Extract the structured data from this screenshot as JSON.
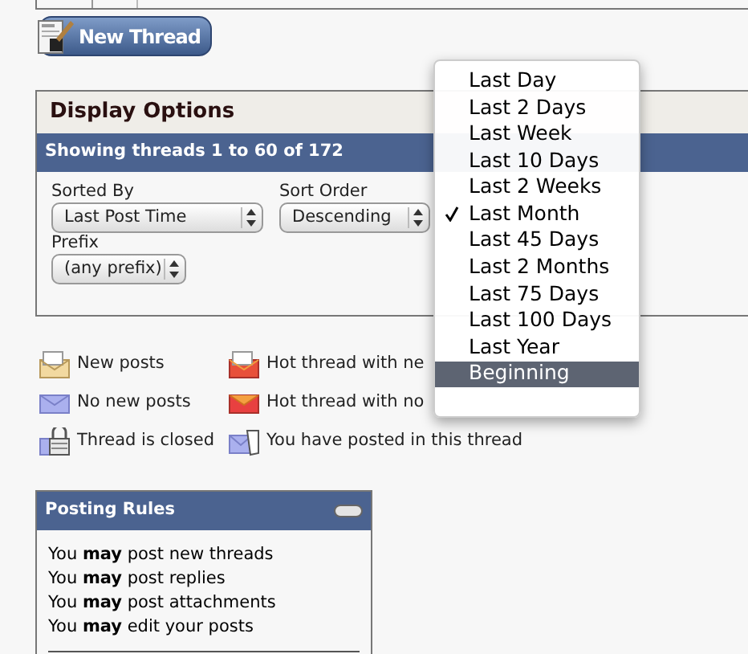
{
  "new_thread_button": {
    "label": "New Thread"
  },
  "display_options": {
    "title": "Display Options",
    "summary": "Showing threads 1 to 60 of 172",
    "fields": [
      {
        "label": "Sorted By",
        "value": "Last Post Time"
      },
      {
        "label": "Sort Order",
        "value": "Descending"
      },
      {
        "label": "Prefix",
        "value": "(any prefix)"
      }
    ]
  },
  "legend": [
    {
      "kind": "new",
      "label": "New posts"
    },
    {
      "kind": "hot_new",
      "label": "Hot thread with ne"
    },
    {
      "kind": "old",
      "label": "No new posts"
    },
    {
      "kind": "hot_old",
      "label": "Hot thread with no"
    },
    {
      "kind": "closed",
      "label": "Thread is closed"
    },
    {
      "kind": "posted",
      "label": "You have posted in this thread"
    }
  ],
  "posting_rules": {
    "title": "Posting Rules",
    "rules": [
      "You **may** post new threads",
      "You **may** post replies",
      "You **may** post attachments",
      "You **may** edit your posts"
    ]
  },
  "time_menu": {
    "items": [
      {
        "label": "Last Day",
        "checked": false,
        "selected": false
      },
      {
        "label": "Last 2 Days",
        "checked": false,
        "selected": false
      },
      {
        "label": "Last Week",
        "checked": false,
        "selected": false
      },
      {
        "label": "Last 10 Days",
        "checked": false,
        "selected": false
      },
      {
        "label": "Last 2 Weeks",
        "checked": false,
        "selected": false
      },
      {
        "label": "Last Month",
        "checked": true,
        "selected": false
      },
      {
        "label": "Last 45 Days",
        "checked": false,
        "selected": false
      },
      {
        "label": "Last 2 Months",
        "checked": false,
        "selected": false
      },
      {
        "label": "Last 75 Days",
        "checked": false,
        "selected": false
      },
      {
        "label": "Last 100 Days",
        "checked": false,
        "selected": false
      },
      {
        "label": "Last Year",
        "checked": false,
        "selected": false
      },
      {
        "label": "Beginning",
        "checked": false,
        "selected": true
      }
    ]
  }
}
